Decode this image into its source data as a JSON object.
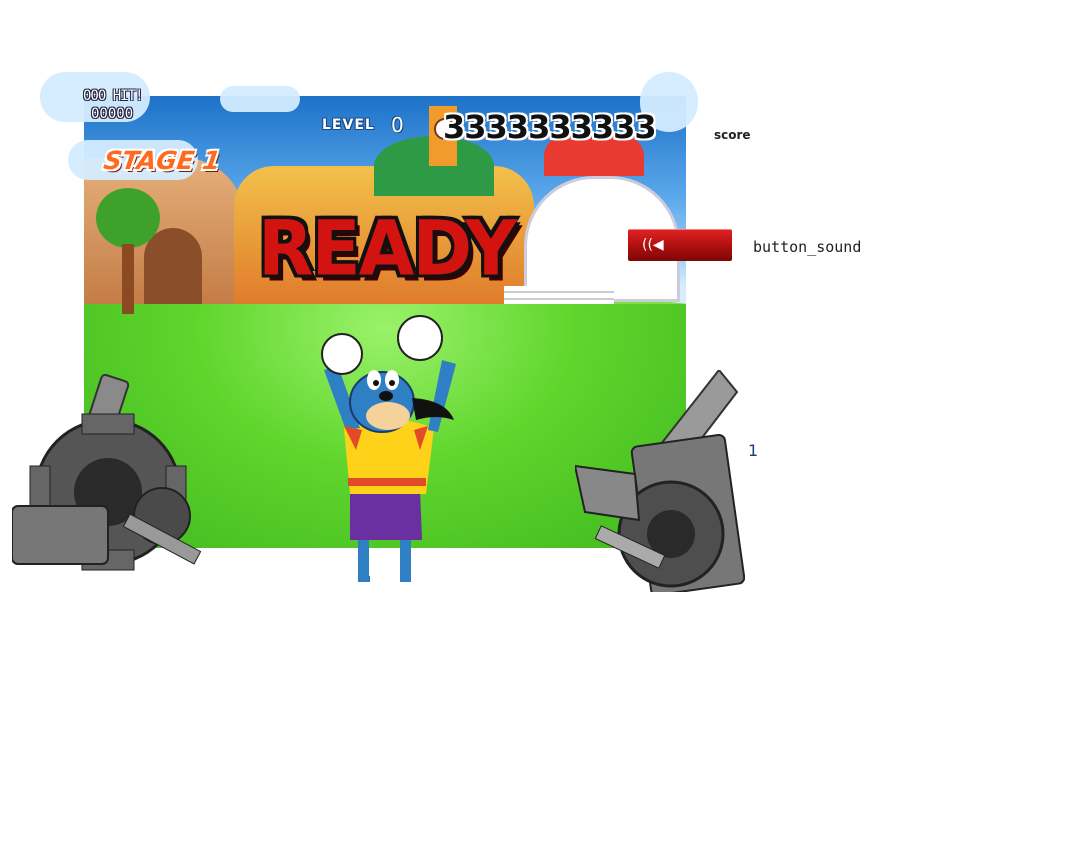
{
  "hud": {
    "hiscore_label": "000 HIT!",
    "hiscore_value": "00000",
    "stage_label": "STAGE 1",
    "level_label": "LEVEL",
    "level_value": "0",
    "score_value": "3333333333",
    "score_caption": "score"
  },
  "banner": {
    "text": "READY"
  },
  "sound": {
    "button_caption": "button_sound",
    "icon": "speaker-icon"
  },
  "counter": {
    "value": "1"
  },
  "colors": {
    "ready": "#d3130f",
    "sound_button": "#c41313",
    "grass": "#5fd52c",
    "sky": "#5aa7ea"
  }
}
